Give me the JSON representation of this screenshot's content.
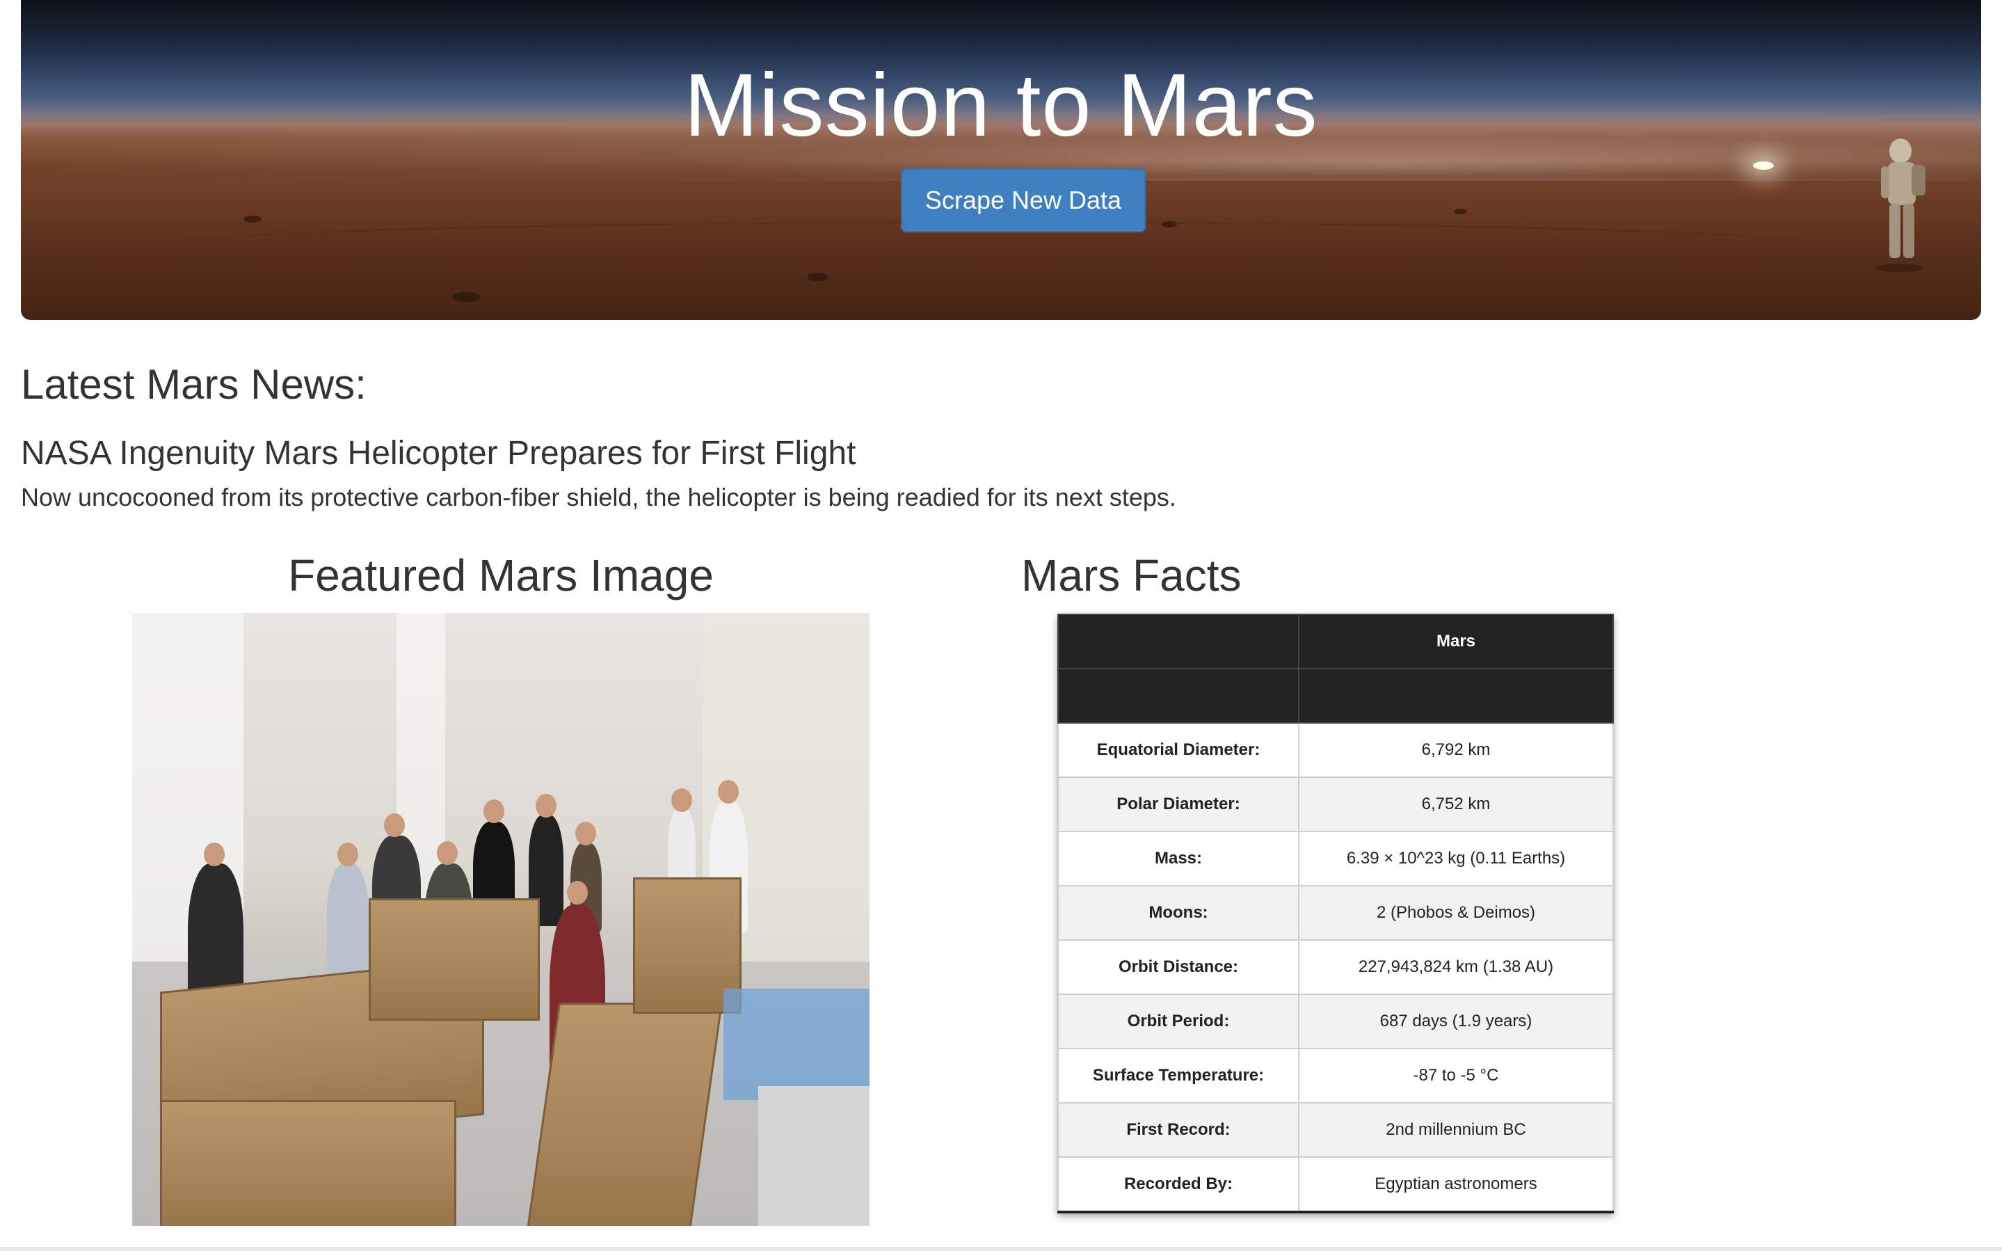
{
  "header": {
    "title": "Mission to Mars",
    "scrape_button_label": "Scrape New Data"
  },
  "news": {
    "heading": "Latest Mars News:",
    "title": "NASA Ingenuity Mars Helicopter Prepares for First Flight",
    "teaser": "Now uncocooned from its protective carbon-fiber shield, the helicopter is being readied for its next steps."
  },
  "featured": {
    "heading": "Featured Mars Image"
  },
  "facts": {
    "heading": "Mars Facts",
    "column_header": "Mars",
    "rows": [
      {
        "label": "Equatorial Diameter:",
        "value": "6,792 km"
      },
      {
        "label": "Polar Diameter:",
        "value": "6,752 km"
      },
      {
        "label": "Mass:",
        "value": "6.39 × 10^23 kg (0.11 Earths)"
      },
      {
        "label": "Moons:",
        "value": "2 (Phobos & Deimos)"
      },
      {
        "label": "Orbit Distance:",
        "value": "227,943,824 km (1.38 AU)"
      },
      {
        "label": "Orbit Period:",
        "value": "687 days (1.9 years)"
      },
      {
        "label": "Surface Temperature:",
        "value": "-87 to -5 °C"
      },
      {
        "label": "First Record:",
        "value": "2nd millennium BC"
      },
      {
        "label": "Recorded By:",
        "value": "Egyptian astronomers"
      }
    ]
  },
  "colors": {
    "button": "#3f7ebf",
    "table_header": "#222222",
    "text": "#333333"
  }
}
